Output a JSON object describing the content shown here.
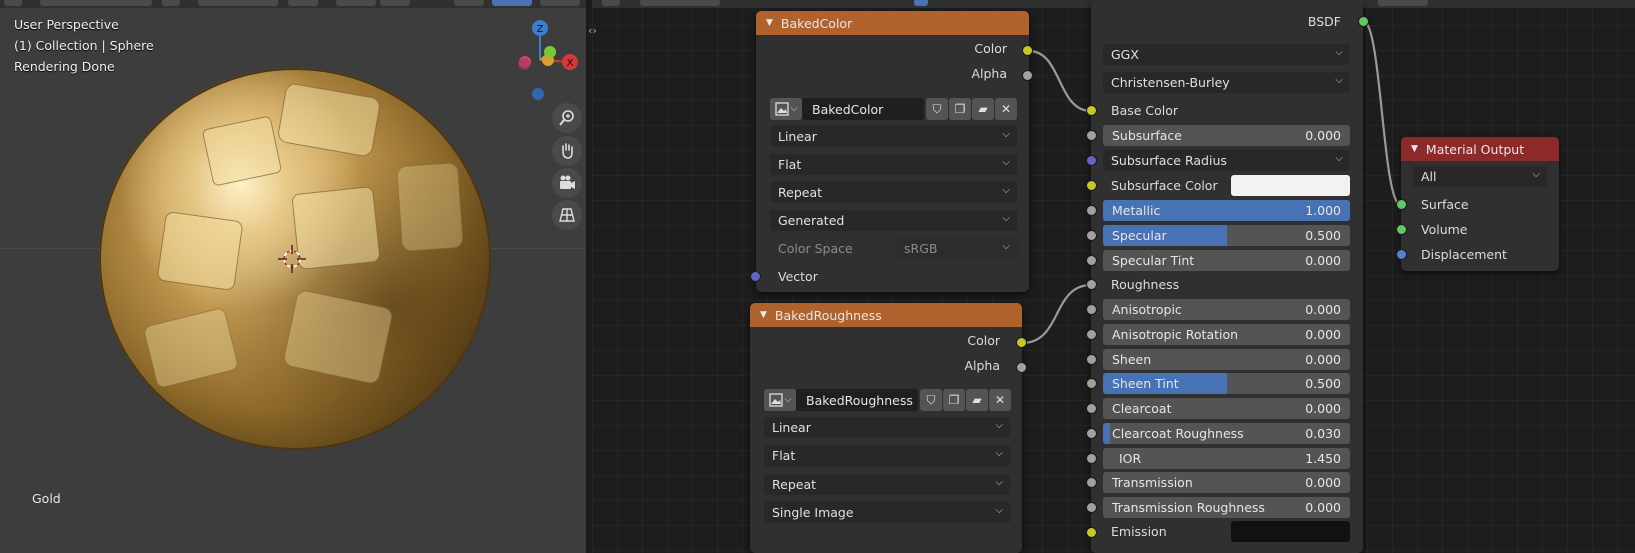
{
  "viewport": {
    "info_lines": [
      "User Perspective",
      "(1) Collection | Sphere",
      "Rendering Done"
    ],
    "material_name": "Gold",
    "gizmo": {
      "z_label": "Z",
      "x_label": "X"
    },
    "nav_icons": [
      "zoom-icon",
      "hand-pan-icon",
      "camera-icon",
      "grid-view-icon"
    ]
  },
  "nodes": {
    "baked_color": {
      "title": "BakedColor",
      "outputs": [
        "Color",
        "Alpha"
      ],
      "image_name": "BakedColor",
      "interpolation": "Linear",
      "projection": "Flat",
      "extension": "Repeat",
      "source": "Generated",
      "color_space_label": "Color Space",
      "color_space_value": "sRGB",
      "vector_label": "Vector"
    },
    "baked_roughness": {
      "title": "BakedRoughness",
      "outputs": [
        "Color",
        "Alpha"
      ],
      "image_name": "BakedRoughness",
      "interpolation": "Linear",
      "projection": "Flat",
      "extension": "Repeat",
      "source": "Single Image"
    },
    "bsdf": {
      "output_label": "BSDF",
      "distribution": "GGX",
      "subsurface_method": "Christensen-Burley",
      "base_color_label": "Base Color",
      "subsurface": {
        "label": "Subsurface",
        "value": "0.000",
        "fill": 0.0
      },
      "subsurface_radius_label": "Subsurface Radius",
      "subsurface_color_label": "Subsurface Color",
      "metallic": {
        "label": "Metallic",
        "value": "1.000",
        "fill": 1.0
      },
      "specular": {
        "label": "Specular",
        "value": "0.500",
        "fill": 0.5
      },
      "specular_tint": {
        "label": "Specular Tint",
        "value": "0.000",
        "fill": 0.0
      },
      "roughness_label": "Roughness",
      "anisotropic": {
        "label": "Anisotropic",
        "value": "0.000",
        "fill": 0.0
      },
      "anisotropic_rotation": {
        "label": "Anisotropic Rotation",
        "value": "0.000",
        "fill": 0.0
      },
      "sheen": {
        "label": "Sheen",
        "value": "0.000",
        "fill": 0.0
      },
      "sheen_tint": {
        "label": "Sheen Tint",
        "value": "0.500",
        "fill": 0.5
      },
      "clearcoat": {
        "label": "Clearcoat",
        "value": "0.000",
        "fill": 0.0
      },
      "clearcoat_roughness": {
        "label": "Clearcoat Roughness",
        "value": "0.030",
        "fill": 0.03
      },
      "ior": {
        "label": "IOR",
        "value": "1.450"
      },
      "transmission": {
        "label": "Transmission",
        "value": "0.000",
        "fill": 0.0
      },
      "transmission_roughness": {
        "label": "Transmission Roughness",
        "value": "0.000",
        "fill": 0.0
      },
      "emission_label": "Emission"
    },
    "material_output": {
      "title": "Material Output",
      "target": "All",
      "inputs": [
        "Surface",
        "Volume",
        "Displacement"
      ]
    }
  },
  "colors": {
    "texture_header": "#b0622d",
    "output_header": "#8c2a2a",
    "slider_fill": "#4772b3",
    "socket_color": "#c7c729",
    "socket_float": "#a1a1a1",
    "socket_shader": "#63c763",
    "socket_vector": "#6363c7"
  }
}
